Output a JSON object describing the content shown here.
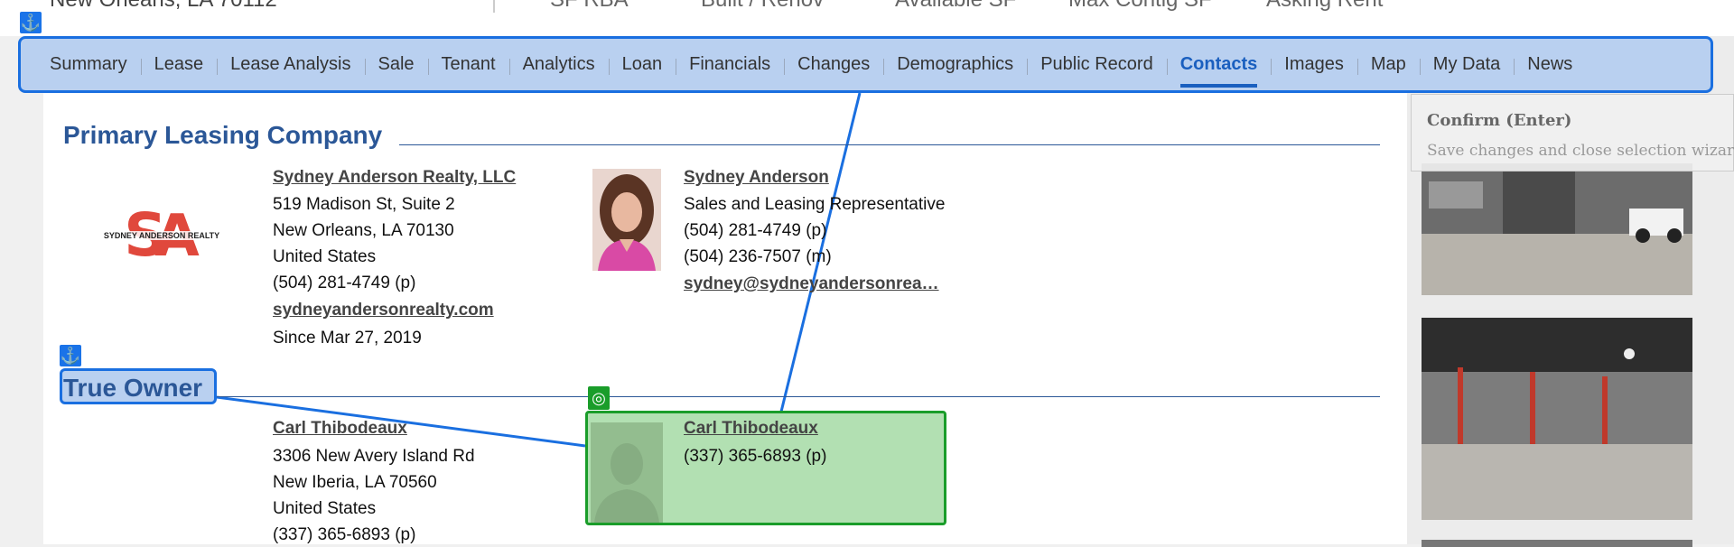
{
  "header": {
    "address": "New Orleans, LA 70112",
    "stats": [
      "SF RBA",
      "Built / Renov",
      "Available SF",
      "Max Contig SF",
      "Asking Rent"
    ]
  },
  "tabs": [
    {
      "label": "Summary"
    },
    {
      "label": "Lease"
    },
    {
      "label": "Lease Analysis"
    },
    {
      "label": "Sale"
    },
    {
      "label": "Tenant"
    },
    {
      "label": "Analytics"
    },
    {
      "label": "Loan"
    },
    {
      "label": "Financials"
    },
    {
      "label": "Changes"
    },
    {
      "label": "Demographics"
    },
    {
      "label": "Public Record"
    },
    {
      "label": "Contacts",
      "active": true
    },
    {
      "label": "Images"
    },
    {
      "label": "Map"
    },
    {
      "label": "My Data"
    },
    {
      "label": "News"
    }
  ],
  "primary_leasing": {
    "title": "Primary Leasing Company",
    "logo_text": "SYDNEY ANDERSON REALTY",
    "company": {
      "name": "Sydney Anderson Realty, LLC",
      "address1": "519 Madison St, Suite 2",
      "address2": "New Orleans, LA 70130",
      "country": "United States",
      "phone": "(504) 281-4749 (p)",
      "website": "sydneyandersonrealty.com",
      "since": "Since Mar 27, 2019"
    },
    "agent": {
      "name": "Sydney Anderson",
      "role": "Sales and Leasing Representative",
      "phone_p": "(504) 281-4749 (p)",
      "phone_m": "(504) 236-7507 (m)",
      "email": "sydney@sydneyandersonrea…"
    }
  },
  "true_owner": {
    "title": "True Owner",
    "owner": {
      "name": "Carl Thibodeaux",
      "address1": "3306 New Avery Island Rd",
      "address2": "New Iberia, LA 70560",
      "country": "United States",
      "phone": "(337) 365-6893 (p)"
    },
    "contact": {
      "name": "Carl Thibodeaux",
      "phone": "(337) 365-6893 (p)"
    }
  },
  "tooltip": {
    "title": "Confirm (Enter)",
    "description": "Save changes and close selection wizard."
  },
  "icons": {
    "anchor": "anchor-icon",
    "target": "target-icon"
  },
  "colors": {
    "selection_blue": "#1a6fe0",
    "selection_green": "#1a9d2a",
    "heading_blue": "#2b5797",
    "logo_red": "#e0483c"
  }
}
